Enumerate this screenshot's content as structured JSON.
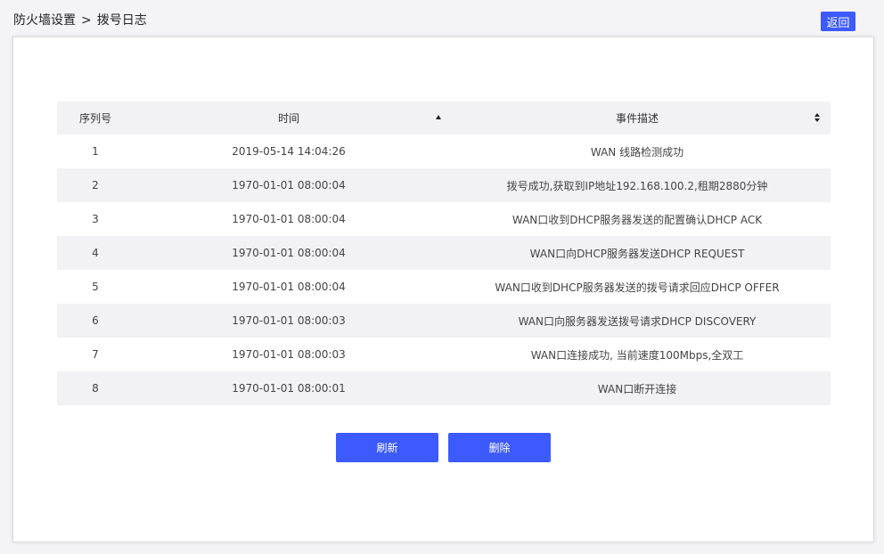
{
  "header": {
    "breadcrumb_parent": "防火墙设置",
    "breadcrumb_sep": ">",
    "breadcrumb_current": "拨号日志",
    "back_label": "返回"
  },
  "table": {
    "columns": [
      "序列号",
      "时间",
      "事件描述"
    ],
    "rows": [
      {
        "id": "1",
        "time": "2019-05-14 14:04:26",
        "desc": "WAN 线路检测成功"
      },
      {
        "id": "2",
        "time": "1970-01-01 08:00:04",
        "desc": "拨号成功,获取到IP地址192.168.100.2,租期2880分钟"
      },
      {
        "id": "3",
        "time": "1970-01-01 08:00:04",
        "desc": "WAN口收到DHCP服务器发送的配置确认DHCP ACK"
      },
      {
        "id": "4",
        "time": "1970-01-01 08:00:04",
        "desc": "WAN口向DHCP服务器发送DHCP REQUEST"
      },
      {
        "id": "5",
        "time": "1970-01-01 08:00:04",
        "desc": "WAN口收到DHCP服务器发送的拨号请求回应DHCP OFFER"
      },
      {
        "id": "6",
        "time": "1970-01-01 08:00:03",
        "desc": "WAN口向服务器发送拨号请求DHCP DISCOVERY"
      },
      {
        "id": "7",
        "time": "1970-01-01 08:00:03",
        "desc": "WAN口连接成功, 当前速度100Mbps,全双工"
      },
      {
        "id": "8",
        "time": "1970-01-01 08:00:01",
        "desc": "WAN口断开连接"
      }
    ]
  },
  "actions": {
    "refresh_label": "刷新",
    "delete_label": "删除"
  },
  "colors": {
    "accent": "#3d5afe",
    "row_alt": "#f2f2f4"
  }
}
